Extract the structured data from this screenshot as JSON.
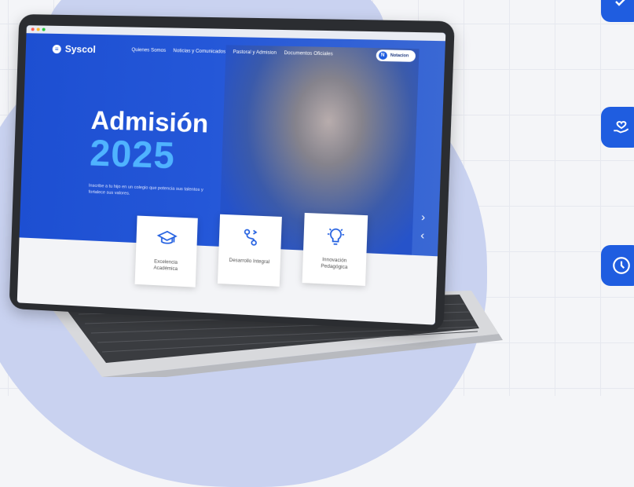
{
  "window": {
    "controls_label": "● ● ●"
  },
  "site": {
    "logo_text": "Syscol",
    "logo_mark": "≡",
    "nav": [
      "Quienes Somos",
      "Noticias y Comunicados",
      "Pastoral y Admision",
      "Documentos Oficiales"
    ],
    "cta_label": "Notacion",
    "cta_icon": "N"
  },
  "hero": {
    "title": "Admisión",
    "year": "2025",
    "subtitle": "Inscribe a tu hijo en un colegio que potencia sus talentos y fortalece sus valores.",
    "next_arrow": "›",
    "prev_arrow": "‹"
  },
  "features": [
    {
      "label": "Excelencia Académica",
      "icon": "graduation-cap-icon"
    },
    {
      "label": "Desarrollo Integral",
      "icon": "growth-path-icon"
    },
    {
      "label": "Innovación Pedagógica",
      "icon": "lightbulb-icon"
    }
  ],
  "colors": {
    "accent": "#1f5de0",
    "year": "#4fb3ff",
    "background_blob": "#c9d2f0"
  }
}
